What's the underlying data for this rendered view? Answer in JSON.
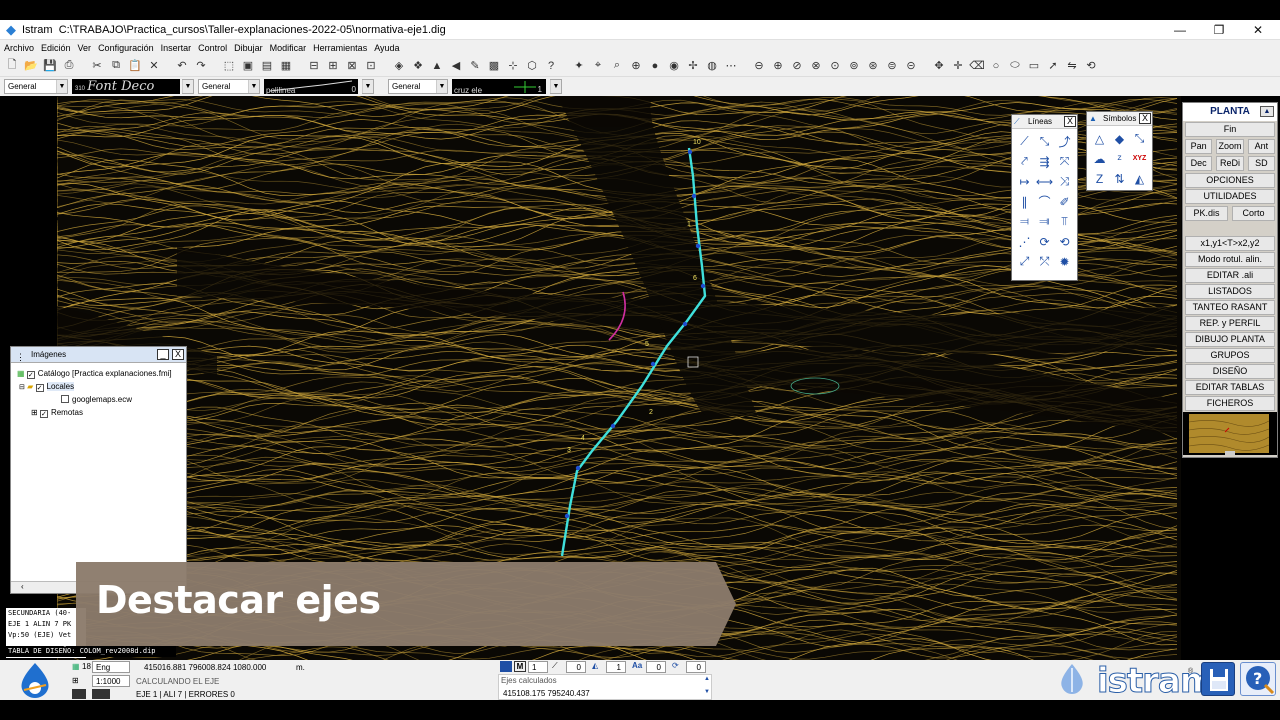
{
  "window": {
    "app_name": "Istram",
    "file_path": "C:\\TRABAJO\\Practica_cursos\\Taller-explanaciones-2022-05\\normativa-eje1.dig",
    "minimize": "—",
    "maximize": "❐",
    "close": "✕"
  },
  "menu": [
    "Archivo",
    "Edición",
    "Ver",
    "Configuración",
    "Insertar",
    "Control",
    "Dibujar",
    "Modificar",
    "Herramientas",
    "Ayuda"
  ],
  "stylebar": {
    "layer1": "General",
    "font_size": "310",
    "font_preview": "Font Deco",
    "layer2": "General",
    "line_preview": "polilinea",
    "line_num": "0",
    "layer3": "General",
    "symbol_preview": "cruz ele",
    "symbol_num": "1"
  },
  "canvas": {
    "axis_labels": [
      "10",
      "6",
      "5",
      "4",
      "3",
      "2",
      "1"
    ]
  },
  "lineas_panel": {
    "title": "Líneas",
    "close": "X"
  },
  "simbolos_panel": {
    "title": "Símbolos",
    "close": "X"
  },
  "planta": {
    "title": "PLANTA",
    "up": "▲",
    "fin": "Fin",
    "row1": [
      "Pan",
      "Zoom",
      "Ant"
    ],
    "row2": [
      "Dec",
      "ReDi",
      "SD"
    ],
    "opciones": "OPCIONES",
    "utilidades": "UTILIDADES",
    "row3": [
      "PK.dis",
      "Corto"
    ],
    "buttons": [
      "x1,y1<T>x2,y2",
      "Modo rotul. alin.",
      "EDITAR .ali",
      "LISTADOS",
      "TANTEO RASANT",
      "REP. y PERFIL",
      "DIBUJO PLANTA",
      "GRUPOS",
      "DISEÑO",
      "EDITAR TABLAS",
      "FICHEROS"
    ]
  },
  "imagenes": {
    "title": "Imágenes",
    "minimize": "_",
    "close": "X",
    "catalog": "Catálogo [Practica explanaciones.fmi]",
    "locales": "Locales",
    "googlemaps": "googlemaps.ecw",
    "remotas": "Remotas"
  },
  "command_lines": [
    "SECUNDARIA (40-",
    "EJE 1 ALIN 7 PK",
    "Vp:50 (EJE) Vet",
    "TABLA DE DISEÑO: COLOM_rev2008d.dip"
  ],
  "banner": {
    "text": "Destacar ejes"
  },
  "status": {
    "num18": "18",
    "mode": "Eng Libre",
    "coords": "415016.881   796008.824   1080.000",
    "unit": "m.",
    "scale": "1:1000",
    "msg1": "CALCULANDO EL EJE",
    "msg2": "EJE 1 | ALI 7 | ERRORES 0",
    "v1": "1",
    "v2": "0",
    "v3": "1",
    "v4": "0",
    "v5": "0",
    "ejes_title": "Ejes calculados",
    "ejes_coords": "415108.175   795240.437",
    "brand": "istram",
    "reg": "®"
  },
  "colors": {
    "contour": "#c9a23a",
    "axis": "#3fe0dc",
    "banner": "#8b7b6b",
    "accent": "#2b5fa8"
  }
}
